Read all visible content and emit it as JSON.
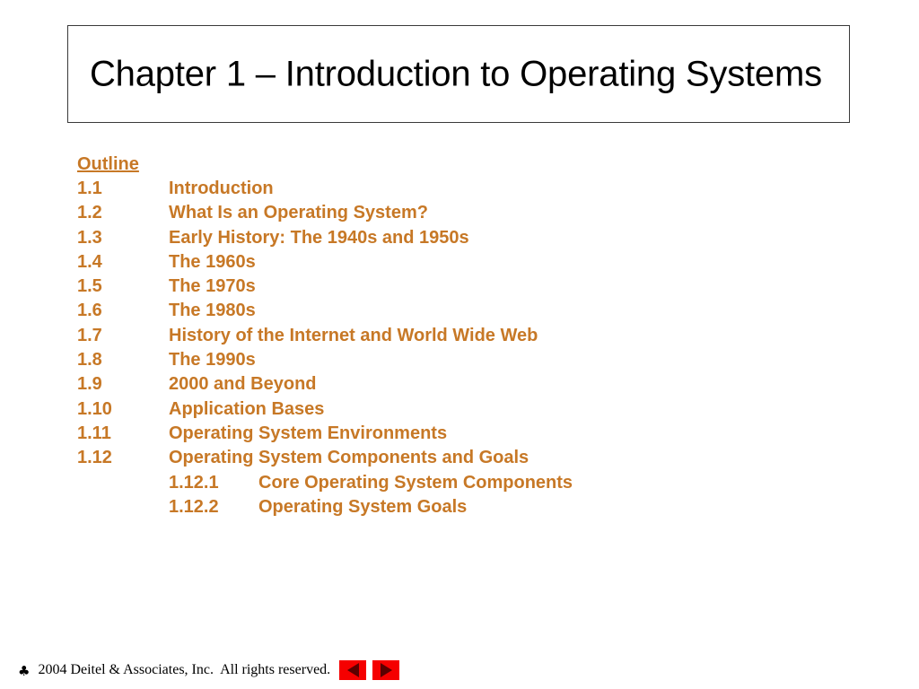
{
  "slide": {
    "title": "Chapter 1 – Introduction to Operating Systems",
    "accent_color": "#C77826",
    "title_color": "#000000",
    "background_color": "#FFFFFF"
  },
  "outline": {
    "heading": "Outline",
    "items": [
      {
        "number": "1.1",
        "label": "Introduction"
      },
      {
        "number": "1.2",
        "label": "What Is an Operating System?"
      },
      {
        "number": "1.3",
        "label": "Early History: The 1940s and 1950s"
      },
      {
        "number": "1.4",
        "label": "The 1960s"
      },
      {
        "number": "1.5",
        "label": "The 1970s"
      },
      {
        "number": "1.6",
        "label": "The 1980s"
      },
      {
        "number": "1.7",
        "label": "History of the Internet and World Wide Web"
      },
      {
        "number": "1.8",
        "label": "The 1990s"
      },
      {
        "number": "1.9",
        "label": "2000 and Beyond"
      },
      {
        "number": "1.10",
        "label": "Application Bases"
      },
      {
        "number": "1.11",
        "label": "Operating System Environments"
      },
      {
        "number": "1.12",
        "label": "Operating System Components and Goals"
      },
      {
        "number": "1.12.1",
        "label": "Core Operating System Components"
      },
      {
        "number": "1.12.2",
        "label": "Operating System Goals"
      }
    ]
  },
  "footer": {
    "copyright_glyph": "♣",
    "text": " 2004 Deitel & Associates, Inc.  All rights reserved.",
    "nav": {
      "previous_label": "◀",
      "next_label": "▶",
      "button_color": "#F50000"
    }
  }
}
